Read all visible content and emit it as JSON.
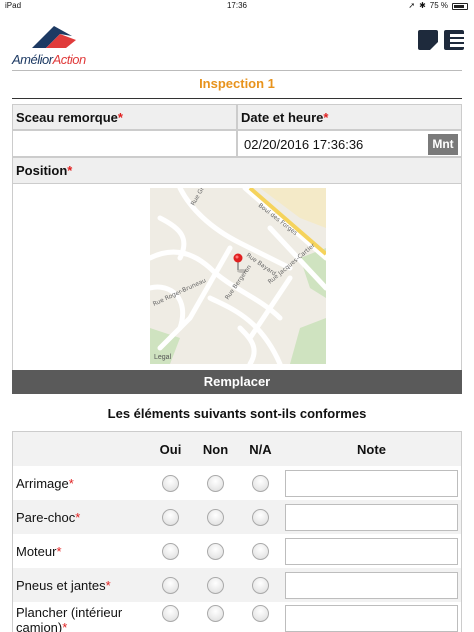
{
  "status_bar": {
    "carrier": "iPad",
    "time": "17:36",
    "battery": "75 %"
  },
  "app": {
    "logo_part1": "Amélior",
    "logo_part2": "Action"
  },
  "page": {
    "title": "Inspection 1"
  },
  "form": {
    "seal_label": "Sceau remorque",
    "date_label": "Date et heure",
    "seal_value": "",
    "date_value": "02/20/2016 17:36:36",
    "now_button": "Mnt",
    "position_label": "Position",
    "required_mark": "*",
    "map_legal": "Legal",
    "map_streets": [
      "Rue Bayard",
      "Boul des Forges",
      "Rue Jacques-Cartier",
      "Rue Bergeron",
      "Rue Roger-Bruneau",
      "Rue Grant"
    ],
    "replace_button": "Remplacer"
  },
  "checklist": {
    "question": "Les éléments suivants sont-ils conformes",
    "col_yes": "Oui",
    "col_no": "Non",
    "col_na": "N/A",
    "col_note": "Note",
    "items": [
      {
        "label": "Arrimage"
      },
      {
        "label": "Pare-choc"
      },
      {
        "label": "Moteur"
      },
      {
        "label": "Pneus et jantes"
      },
      {
        "label": "Plancher (intérieur camion)"
      }
    ]
  },
  "colors": {
    "title": "#e8931c",
    "required": "#e02020",
    "button_dark": "#5a5a5a",
    "button_mid": "#7a7a7a",
    "header_icons": "#1e2a3c"
  }
}
